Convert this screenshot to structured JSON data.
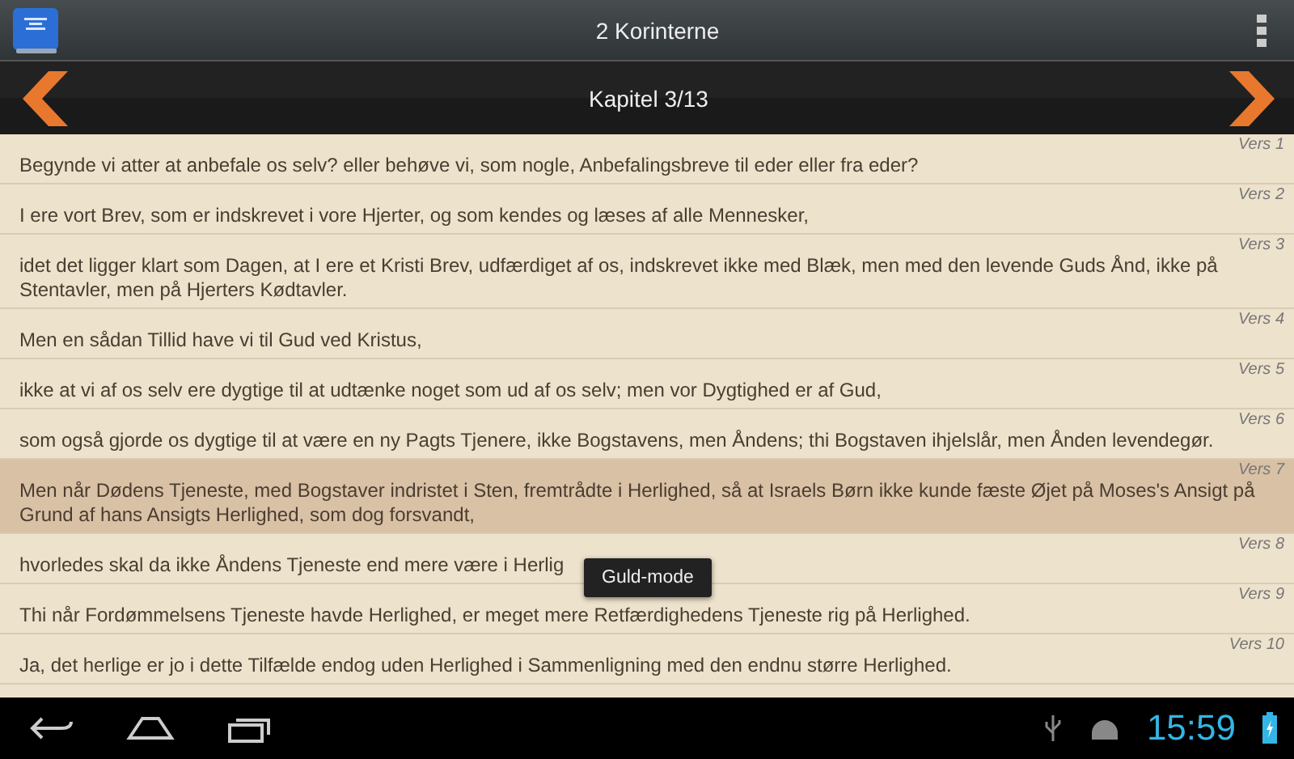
{
  "action_bar": {
    "title": "2 Korinterne"
  },
  "chapter_bar": {
    "title": "Kapitel 3/13"
  },
  "verses": [
    {
      "label": "Vers 1",
      "text": "Begynde vi atter at anbefale os selv? eller behøve vi, som nogle, Anbefalingsbreve til eder eller fra eder?",
      "selected": false
    },
    {
      "label": "Vers 2",
      "text": "I ere vort Brev, som er indskrevet i vore Hjerter, og som kendes og læses af alle Mennesker,",
      "selected": false
    },
    {
      "label": "Vers 3",
      "text": "idet det ligger klart som Dagen, at I ere et Kristi Brev, udfærdiget af os, indskrevet ikke med Blæk, men med den levende Guds Ånd, ikke på Stentavler, men på Hjerters Kødtavler.",
      "selected": false
    },
    {
      "label": "Vers 4",
      "text": "Men en sådan Tillid have vi til Gud ved Kristus,",
      "selected": false
    },
    {
      "label": "Vers 5",
      "text": "ikke at vi af os selv ere dygtige til at udtænke noget som ud af os selv; men vor Dygtighed er af Gud,",
      "selected": false
    },
    {
      "label": "Vers 6",
      "text": "som også gjorde os dygtige til at være en ny Pagts Tjenere, ikke Bogstavens, men Åndens; thi Bogstaven ihjelslår, men Ånden levendegør.",
      "selected": false
    },
    {
      "label": "Vers 7",
      "text": "Men når Dødens Tjeneste, med Bogstaver indristet i Sten, fremtrådte i Herlighed, så at Israels Børn ikke kunde fæste Øjet på Moses's Ansigt på Grund af hans Ansigts Herlighed, som dog forsvandt,",
      "selected": true
    },
    {
      "label": "Vers 8",
      "text": "hvorledes skal da ikke Åndens Tjeneste end mere være i Herlig",
      "selected": false
    },
    {
      "label": "Vers 9",
      "text": "Thi når Fordømmelsens Tjeneste havde Herlighed, er meget mere Retfærdighedens Tjeneste rig på Herlighed.",
      "selected": false
    },
    {
      "label": "Vers 10",
      "text": "Ja, det herlige er jo i dette Tilfælde endog uden Herlighed i Sammenligning med den endnu større Herlighed.",
      "selected": false
    }
  ],
  "toast": {
    "text": "Guld-mode"
  },
  "status_bar": {
    "time": "15:59"
  }
}
